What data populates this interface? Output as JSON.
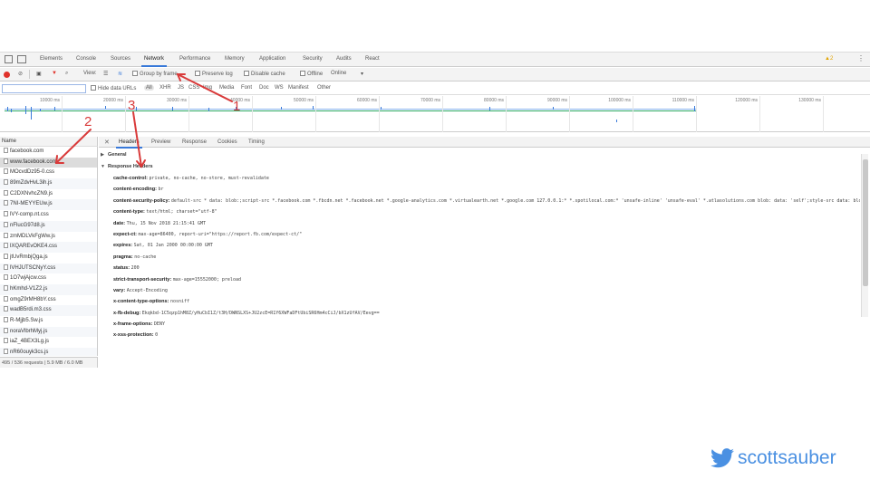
{
  "devtools": {
    "tabs": [
      "Elements",
      "Console",
      "Sources",
      "Network",
      "Performance",
      "Memory",
      "Application",
      "Security",
      "Audits",
      "React"
    ],
    "active_tab": "Network",
    "warning_count": "2"
  },
  "toolbar": {
    "view_label": "View:",
    "group_by_frame": "Group by frame",
    "preserve_log": "Preserve log",
    "disable_cache": "Disable cache",
    "offline": "Offline",
    "throttle": "Online"
  },
  "filter": {
    "value": "",
    "hide_data_urls": "Hide data URLs",
    "types": [
      "All",
      "XHR",
      "JS",
      "CSS",
      "Img",
      "Media",
      "Font",
      "Doc",
      "WS",
      "Manifest",
      "Other"
    ]
  },
  "timeline": {
    "ticks": [
      "10000 ms",
      "20000 ms",
      "30000 ms",
      "40000 ms",
      "50000 ms",
      "60000 ms",
      "70000 ms",
      "80000 ms",
      "90000 ms",
      "100000 ms",
      "110000 ms",
      "120000 ms",
      "130000 ms"
    ]
  },
  "requests": {
    "header": "Name",
    "rows": [
      "facebook.com",
      "www.facebook.com",
      "MOcvdDz95-0.css",
      "89mZdvHvL3ih.js",
      "C2DXNvhcZN9.js",
      "7NI-MEYYEUw.js",
      "lVY-comp.nt.css",
      "nFlucG97d8.js",
      "zmMDLVkFgWw.js",
      "lXQAREvOKE4.css",
      "jtUvRmbjQga.js",
      "lVHJUTSCNyY.css",
      "1O7wjAjcw.css",
      "hKmhd-V1Z2.js",
      "omgZ9rMH8bY.css",
      "wadB5rdi.m3.css",
      "R-Mjjb5.Sw.js",
      "noraVlbrhMyj.js",
      "iaZ_4BEX3Lg.js",
      "nR60ouyk3cs.js"
    ],
    "selected_index": 1,
    "status": "495 / 536 requests | 5.9 MB / 6.0 MB"
  },
  "details": {
    "tabs": [
      "Headers",
      "Preview",
      "Response",
      "Cookies",
      "Timing"
    ],
    "active_tab": "Headers",
    "general_label": "General",
    "response_headers_label": "Response Headers",
    "headers": [
      {
        "key": "cache-control:",
        "value": "private, no-cache, no-store, must-revalidate"
      },
      {
        "key": "content-encoding:",
        "value": "br"
      },
      {
        "key": "content-security-policy:",
        "value": "default-src * data: blob:;script-src *.facebook.com *.fbcdn.net *.facebook.net *.google-analytics.com *.virtualearth.net *.google.com 127.0.0.1:* *.spotilocal.com:* 'unsafe-inline' 'unsafe-eval' *.atlasolutions.com blob: data: 'self';style-src data: blob: 'unsafe-inline' *;connect-src *.facebook.com facebook.com *.fbcdn.net *.facebook.net *.spotilocal.com:* wss://*.facebook.com:* https://fb.scanandcleanlocal.com:* *.atlasolutions.com attachment.fbsbx.com ws://localhost:* blob: *.cdninstagram.com 'self' chrome-extension://boadgeojelhgndaghljhdicfkmllpafd chrome-extension://dliochdbjfkdbacpmhlcpmleaejidimm;"
      },
      {
        "key": "content-type:",
        "value": "text/html; charset=\"utf-8\""
      },
      {
        "key": "date:",
        "value": "Thu, 15 Nov 2018 21:15:41 GMT"
      },
      {
        "key": "expect-ct:",
        "value": "max-age=86400, report-uri=\"https://report.fb.com/expect-ct/\""
      },
      {
        "key": "expires:",
        "value": "Sat, 01 Jan 2000 00:00:00 GMT"
      },
      {
        "key": "pragma:",
        "value": "no-cache"
      },
      {
        "key": "status:",
        "value": "200"
      },
      {
        "key": "strict-transport-security:",
        "value": "max-age=15552000; preload"
      },
      {
        "key": "vary:",
        "value": "Accept-Encoding"
      },
      {
        "key": "x-content-type-options:",
        "value": "nosniff"
      },
      {
        "key": "x-fb-debug:",
        "value": "Ekqkbd-1C5qzp1hM8Z/yHuCbI1Z/t3H/DWNSLXS+JU2zcE=R1Y6XWFaDFtUbiSR6Hm4cCiJ/bX1zUfAV/Eevg=="
      },
      {
        "key": "x-frame-options:",
        "value": "DENY"
      },
      {
        "key": "x-xss-protection:",
        "value": "0"
      }
    ]
  },
  "annotations": [
    "1",
    "2",
    "3"
  ],
  "brand": {
    "handle": "scottsauber",
    "icon": "twitter-bird-icon",
    "color": "#4a90e2"
  },
  "colors": {
    "accent": "#3879d9",
    "annotation": "#d93a3a",
    "record": "#e0312a"
  }
}
